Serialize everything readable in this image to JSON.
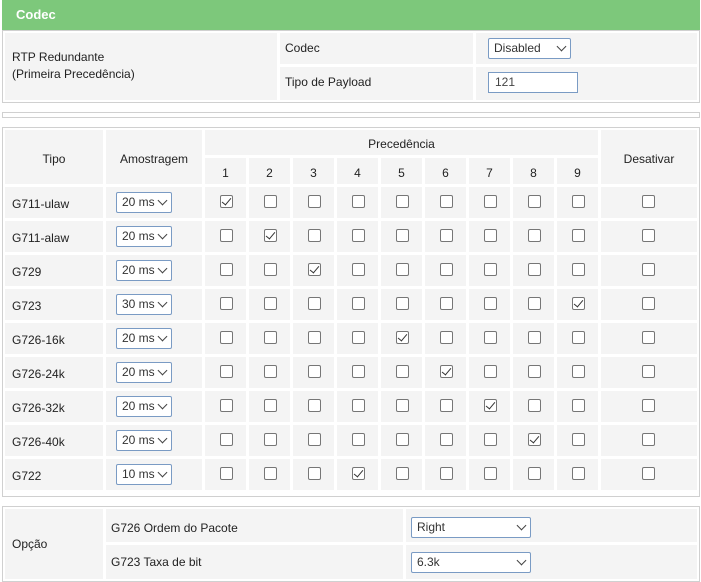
{
  "header": {
    "title": "Codec"
  },
  "rtp": {
    "label_line1": "RTP Redundante",
    "label_line2": "(Primeira Precedência)",
    "codec_label": "Codec",
    "codec_value": "Disabled",
    "payload_label": "Tipo de Payload",
    "payload_value": "121"
  },
  "table": {
    "col_tipo": "Tipo",
    "col_amostragem": "Amostragem",
    "col_precedencia": "Precedência",
    "col_desativar": "Desativar",
    "precedence_numbers": [
      "1",
      "2",
      "3",
      "4",
      "5",
      "6",
      "7",
      "8",
      "9"
    ],
    "rows": [
      {
        "name": "G711-ulaw",
        "sampling": "20 ms",
        "checked": 1
      },
      {
        "name": "G711-alaw",
        "sampling": "20 ms",
        "checked": 2
      },
      {
        "name": "G729",
        "sampling": "20 ms",
        "checked": 3
      },
      {
        "name": "G723",
        "sampling": "30 ms",
        "checked": 9
      },
      {
        "name": "G726-16k",
        "sampling": "20 ms",
        "checked": 5
      },
      {
        "name": "G726-24k",
        "sampling": "20 ms",
        "checked": 6
      },
      {
        "name": "G726-32k",
        "sampling": "20 ms",
        "checked": 7
      },
      {
        "name": "G726-40k",
        "sampling": "20 ms",
        "checked": 8
      },
      {
        "name": "G722",
        "sampling": "10 ms",
        "checked": 4
      }
    ]
  },
  "options": {
    "label": "Opção",
    "packet_order_label": "G726 Ordem do Pacote",
    "packet_order_value": "Right",
    "bitrate_label": "G723 Taxa de bit",
    "bitrate_value": "6.3k"
  }
}
